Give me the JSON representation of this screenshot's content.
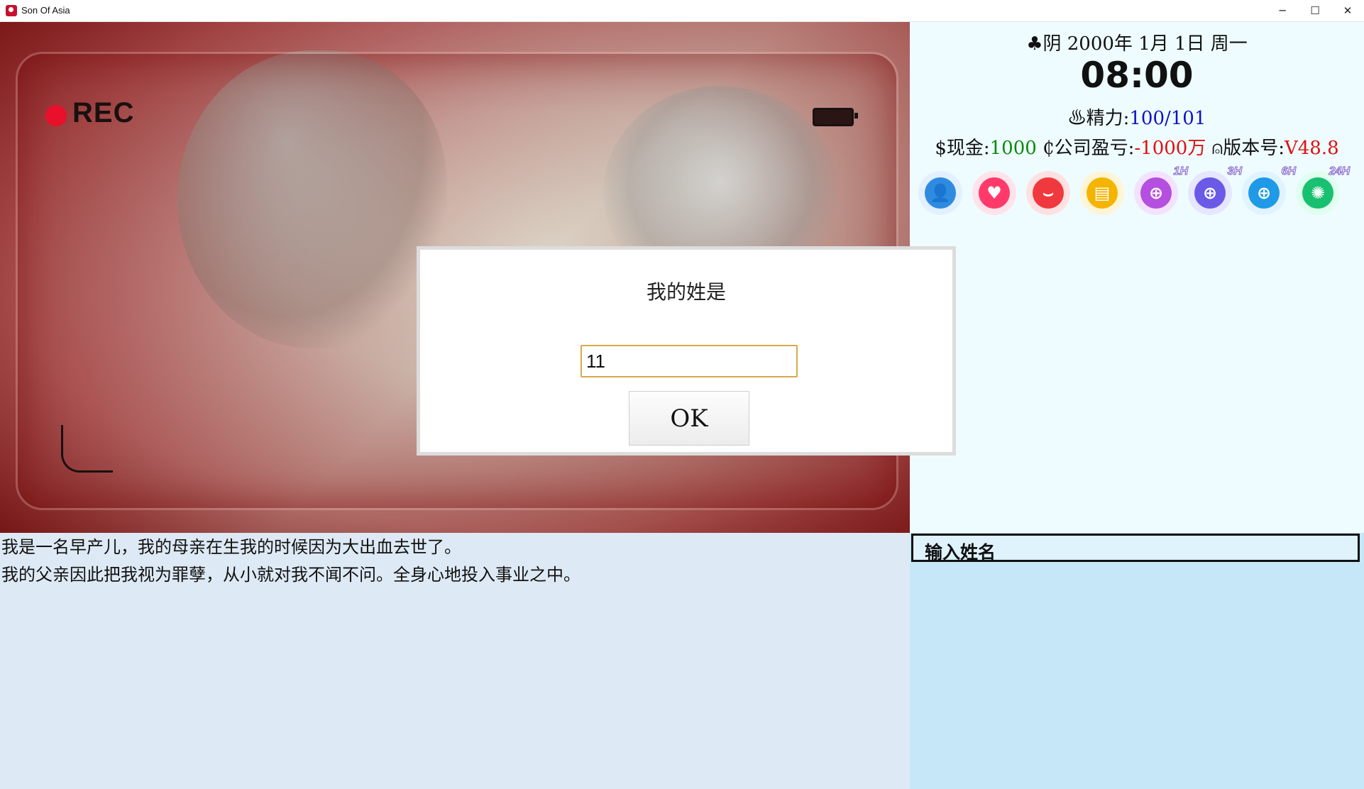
{
  "window": {
    "title": "Son Of Asia",
    "minimize_glyph": "─",
    "maximize_glyph": "☐",
    "close_glyph": "✕"
  },
  "scene": {
    "rec_label": "REC"
  },
  "status": {
    "weather_icon": "♣",
    "date_text": "阴 2000年 1月 1日 周一",
    "time": "08:00",
    "energy_icon": "♨",
    "energy_label": "精力:",
    "energy_value": "100/101",
    "cash_label": "$现金:",
    "cash_value": "1000",
    "company_label": " ₵公司盈亏:",
    "company_value": "-1000万",
    "version_label": " ⍝版本号:",
    "version_value": "V48.8"
  },
  "toolbar": {
    "icons": [
      {
        "name": "character-icon",
        "glyph": "👤"
      },
      {
        "name": "favor-icon",
        "glyph": "♥"
      },
      {
        "name": "shop-icon",
        "glyph": "⌣"
      },
      {
        "name": "notes-icon",
        "glyph": "▤"
      },
      {
        "name": "wait-1h-icon",
        "glyph": "⊕",
        "badge": "1H"
      },
      {
        "name": "wait-3h-icon",
        "glyph": "⊕",
        "badge": "3H"
      },
      {
        "name": "wait-6h-icon",
        "glyph": "⊕",
        "badge": "6H"
      },
      {
        "name": "wait-24h-icon",
        "glyph": "✺",
        "badge": "24H"
      }
    ]
  },
  "story": {
    "line1": "我是一名早产儿，我的母亲在生我的时候因为大出血去世了。",
    "line2": "我的父亲因此把我视为罪孽，从小就对我不闻不问。全身心地投入事业之中。"
  },
  "side": {
    "header": "输入姓名"
  },
  "dialog": {
    "prompt": "我的姓是",
    "input_value": "11",
    "ok_label": "OK"
  },
  "colors": {
    "energy_value": "#1010c8",
    "cash_value": "#0a8a0a",
    "negative_value": "#e01010",
    "story_bg": "#dde9f4",
    "side_bg": "#c6e7f8",
    "panel_bg": "#eefcff"
  }
}
